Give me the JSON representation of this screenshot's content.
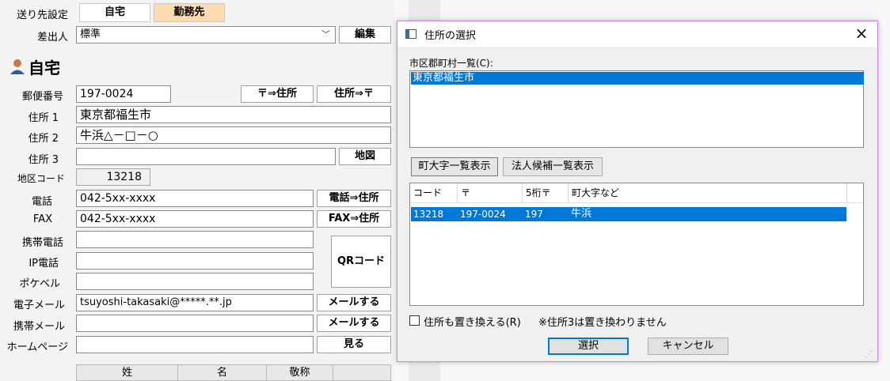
{
  "form": {
    "send_settings_label": "送り先設定",
    "tabs": [
      "自宅",
      "勤務先"
    ],
    "sender_label": "差出人",
    "sender_value": "標準",
    "edit_button": "編集",
    "section_title": "自宅",
    "postal_label": "郵便番号",
    "postal_value": "197-0024",
    "zip_to_addr_button": "〒⇒住所",
    "addr_to_zip_button": "住所⇒〒",
    "addr1_label": "住所 1",
    "addr1_value": "東京都福生市",
    "addr2_label": "住所 2",
    "addr2_value": "牛浜△－□－○",
    "addr3_label": "住所 3",
    "addr3_value": "",
    "map_button": "地図",
    "district_label": "地区コード",
    "district_value": "13218",
    "phone_label": "電話",
    "phone_value": "042-5xx-xxxx",
    "phone_to_addr_button": "電話⇒住所",
    "fax_label": "FAX",
    "fax_value": "042-5xx-xxxx",
    "fax_to_addr_button": "FAX⇒住所",
    "mobile_label": "携帯電話",
    "ip_phone_label": "IP電話",
    "pager_label": "ポケベル",
    "qr_button": "QRコード",
    "email_label": "電子メール",
    "email_value": "tsuyoshi-takasaki@*****.**.jp",
    "send_mail_button": "メールする",
    "mobile_mail_label": "携帯メール",
    "send_mail_button2": "メールする",
    "homepage_label": "ホームページ",
    "view_button": "見る",
    "name_table_headers": [
      "姓",
      "名",
      "敬称"
    ]
  },
  "dialog": {
    "title": "住所の選択",
    "close_icon": "×",
    "city_list_label": "市区郡町村一覧(C):",
    "city_items": [
      "東京都福生市"
    ],
    "town_list_button": "町大字一覧表示",
    "corp_list_button": "法人候補一覧表示",
    "columns": [
      "コード",
      "〒",
      "5桁〒",
      "町大字など"
    ],
    "rows": [
      {
        "code": "13218",
        "zip": "197-0024",
        "zip5": "197",
        "town": "牛浜"
      }
    ],
    "replace_checkbox_label": "住所も置き換える(R)",
    "note": "※住所3は置き換わりません",
    "select_button": "選択",
    "cancel_button": "キャンセル"
  }
}
